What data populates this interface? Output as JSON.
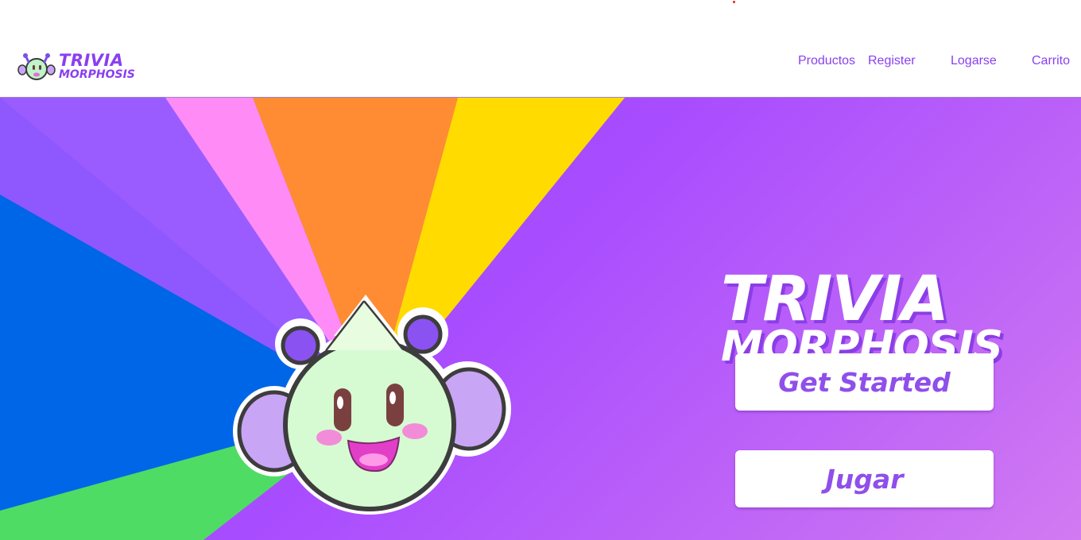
{
  "brand": {
    "logo_line1": "TRIVIA",
    "logo_line2": "MORPHOSIS",
    "accent_color": "#8a3ff0"
  },
  "nav": {
    "items": [
      {
        "label": "Productos"
      },
      {
        "label": "Register"
      },
      {
        "label": "Logarse"
      },
      {
        "label": "Carrito"
      }
    ]
  },
  "hero": {
    "title_line1": "TRIVIA",
    "title_line2": "MORPHOSIS",
    "get_started_label": "Get Started",
    "play_label": "Jugar",
    "mascot_icon": "mascot-character-icon",
    "ray_colors": [
      "#8f58ff",
      "#ff8cf6",
      "#ff8c32",
      "#ffdb00",
      "#0066e8",
      "#4fdc64"
    ]
  }
}
